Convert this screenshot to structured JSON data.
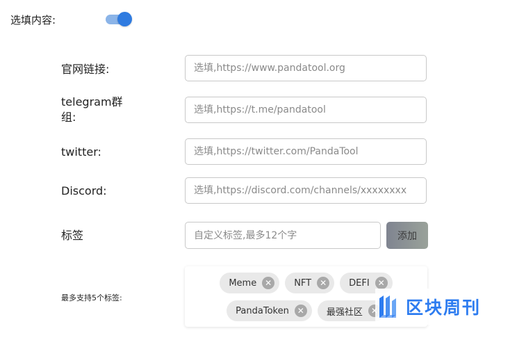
{
  "toggle_section": {
    "label": "选填内容:",
    "enabled": true,
    "active_color": "#2f7be0"
  },
  "fields": {
    "website": {
      "label": "官网链接:",
      "placeholder": "选填,https://www.pandatool.org",
      "value": ""
    },
    "telegram": {
      "label": "telegram群组:",
      "placeholder": "选填,https://t.me/pandatool",
      "value": ""
    },
    "twitter": {
      "label": "twitter:",
      "placeholder": "选填,https://twitter.com/PandaTool",
      "value": ""
    },
    "discord": {
      "label": "Discord:",
      "placeholder": "选填,https://discord.com/channels/xxxxxxxx",
      "value": ""
    }
  },
  "tags": {
    "label": "标签",
    "placeholder": "自定义标签,最多12个字",
    "add_button_label": "添加",
    "max_hint": "最多支持5个标签:",
    "items": [
      {
        "text": "Meme",
        "remove_icon": "close-circle-icon"
      },
      {
        "text": "NFT",
        "remove_icon": "close-circle-icon"
      },
      {
        "text": "DEFI",
        "remove_icon": "close-circle-icon"
      },
      {
        "text": "PandaToken",
        "remove_icon": "close-circle-icon"
      },
      {
        "text": "最强社区",
        "remove_icon": "close-circle-icon"
      }
    ]
  },
  "watermark": {
    "brand": "区块周刊",
    "logo_icon": "blockchain-weekly-logo-icon",
    "color": "#2d7cf0"
  }
}
